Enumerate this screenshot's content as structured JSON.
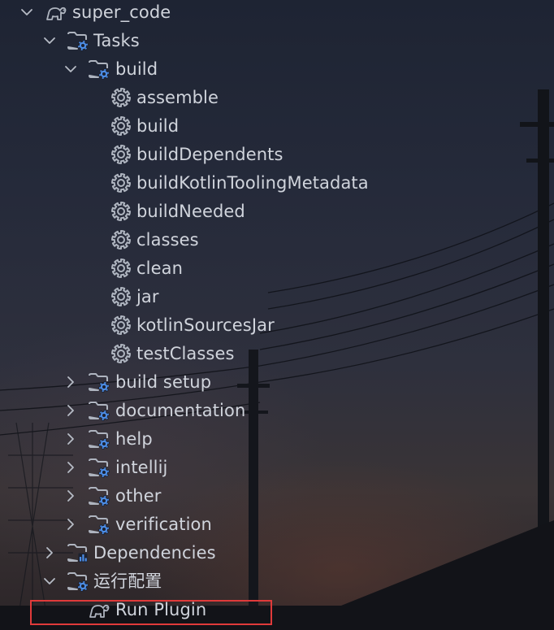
{
  "tree": {
    "root": {
      "label": "super_code",
      "icon": "gradle-elephant-icon",
      "expanded": true
    },
    "tasks": {
      "label": "Tasks",
      "icon": "folder-gear-icon",
      "expanded": true
    },
    "build_group": {
      "label": "build",
      "icon": "folder-gear-icon",
      "expanded": true
    },
    "build_tasks": [
      {
        "label": "assemble",
        "icon": "gear-icon"
      },
      {
        "label": "build",
        "icon": "gear-icon"
      },
      {
        "label": "buildDependents",
        "icon": "gear-icon"
      },
      {
        "label": "buildKotlinToolingMetadata",
        "icon": "gear-icon"
      },
      {
        "label": "buildNeeded",
        "icon": "gear-icon"
      },
      {
        "label": "classes",
        "icon": "gear-icon"
      },
      {
        "label": "clean",
        "icon": "gear-icon"
      },
      {
        "label": "jar",
        "icon": "gear-icon"
      },
      {
        "label": "kotlinSourcesJar",
        "icon": "gear-icon"
      },
      {
        "label": "testClasses",
        "icon": "gear-icon"
      }
    ],
    "task_groups": [
      {
        "label": "build setup",
        "icon": "folder-gear-icon",
        "expanded": false
      },
      {
        "label": "documentation",
        "icon": "folder-gear-icon",
        "expanded": false
      },
      {
        "label": "help",
        "icon": "folder-gear-icon",
        "expanded": false
      },
      {
        "label": "intellij",
        "icon": "folder-gear-icon",
        "expanded": false
      },
      {
        "label": "other",
        "icon": "folder-gear-icon",
        "expanded": false
      },
      {
        "label": "verification",
        "icon": "folder-gear-icon",
        "expanded": false
      }
    ],
    "dependencies": {
      "label": "Dependencies",
      "icon": "folder-chart-icon",
      "expanded": false
    },
    "run_configs": {
      "label": "运行配置",
      "icon": "folder-gear-icon",
      "expanded": true
    },
    "run_plugin": {
      "label": "Run Plugin",
      "icon": "gradle-elephant-icon"
    }
  },
  "colors": {
    "text": "#d0d4dc",
    "icon_stroke": "#aeb4bf",
    "gear_badge": "#4c8de6",
    "highlight_border": "#e03a3a"
  }
}
